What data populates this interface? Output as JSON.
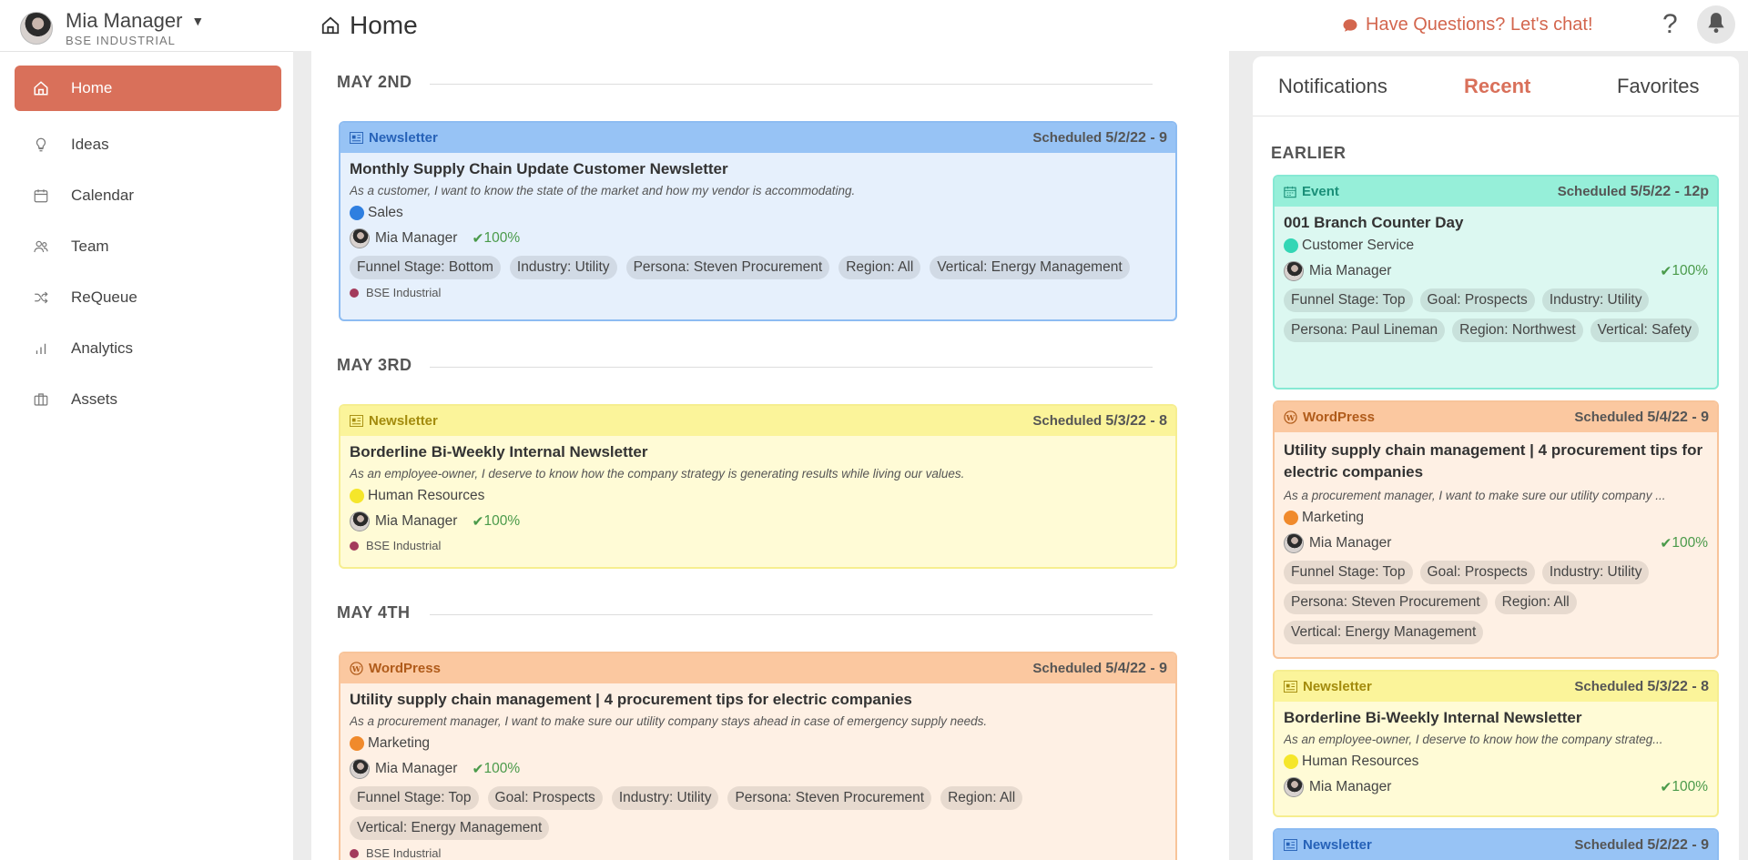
{
  "header": {
    "user_name": "Mia Manager",
    "user_org": "BSE INDUSTRIAL",
    "page_title": "Home",
    "chat_label": "Have Questions? Let's chat!",
    "help_glyph": "?"
  },
  "sidebar": {
    "items": [
      {
        "label": "Home",
        "icon": "home-icon",
        "active": true
      },
      {
        "label": "Ideas",
        "icon": "lightbulb-icon"
      },
      {
        "label": "Calendar",
        "icon": "calendar-icon"
      },
      {
        "label": "Team",
        "icon": "team-icon"
      },
      {
        "label": "ReQueue",
        "icon": "shuffle-icon"
      },
      {
        "label": "Analytics",
        "icon": "bar-chart-icon"
      },
      {
        "label": "Assets",
        "icon": "briefcase-icon"
      }
    ]
  },
  "main": {
    "days": [
      "MAY 2ND",
      "MAY 3RD",
      "MAY 4TH"
    ],
    "cards": [
      {
        "type": "Newsletter",
        "sched_label": "Scheduled",
        "sched_value": "5/2/22 - 9",
        "title": "Monthly Supply Chain Update Customer Newsletter",
        "desc": "As a customer, I want to know the state of the market and how my vendor is accommodating.",
        "dept": "Sales",
        "owner": "Mia Manager",
        "pct": "100%",
        "tags": [
          "Funnel Stage: Bottom",
          "Industry: Utility",
          "Persona: Steven Procurement",
          "Region: All",
          "Vertical: Energy Management"
        ],
        "org": "BSE Industrial"
      },
      {
        "type": "Newsletter",
        "sched_label": "Scheduled",
        "sched_value": "5/3/22 - 8",
        "title": "Borderline Bi-Weekly Internal Newsletter",
        "desc": "As an employee-owner, I deserve to know how the company strategy is generating results while living our values.",
        "dept": "Human Resources",
        "owner": "Mia Manager",
        "pct": "100%",
        "org": "BSE Industrial"
      },
      {
        "type": "WordPress",
        "sched_label": "Scheduled",
        "sched_value": "5/4/22 - 9",
        "title": "Utility supply chain management | 4 procurement tips for electric companies",
        "desc": "As a procurement manager, I want to make sure our utility company stays ahead in case of emergency supply needs.",
        "dept": "Marketing",
        "owner": "Mia Manager",
        "pct": "100%",
        "tags": [
          "Funnel Stage: Top",
          "Goal: Prospects",
          "Industry: Utility",
          "Persona: Steven Procurement",
          "Region: All",
          "Vertical: Energy Management"
        ],
        "org": "BSE Industrial"
      }
    ]
  },
  "right_panel": {
    "tabs": [
      "Notifications",
      "Recent",
      "Favorites"
    ],
    "section": "EARLIER",
    "cards": [
      {
        "type": "Event",
        "sched_label": "Scheduled",
        "sched_value": "5/5/22 - 12p",
        "title": "001 Branch Counter Day",
        "dept": "Customer Service",
        "owner": "Mia Manager",
        "pct": "100%",
        "tags": [
          "Funnel Stage: Top",
          "Goal: Prospects",
          "Industry: Utility",
          "Persona: Paul Lineman",
          "Region: Northwest",
          "Vertical: Safety"
        ]
      },
      {
        "type": "WordPress",
        "sched_label": "Scheduled",
        "sched_value": "5/4/22 - 9",
        "title": "Utility supply chain management | 4 procurement tips for electric companies",
        "desc": "As a procurement manager, I want to make sure our utility company ...",
        "dept": "Marketing",
        "owner": "Mia Manager",
        "pct": "100%",
        "tags": [
          "Funnel Stage: Top",
          "Goal: Prospects",
          "Industry: Utility",
          "Persona: Steven Procurement",
          "Region: All",
          "Vertical: Energy Management"
        ]
      },
      {
        "type": "Newsletter",
        "sched_label": "Scheduled",
        "sched_value": "5/3/22 - 8",
        "title": "Borderline Bi-Weekly Internal Newsletter",
        "desc": "As an employee-owner, I deserve to know how the company strateg...",
        "dept": "Human Resources",
        "owner": "Mia Manager",
        "pct": "100%"
      },
      {
        "type": "Newsletter",
        "sched_label": "Scheduled",
        "sched_value": "5/2/22 - 9"
      }
    ]
  },
  "colors": {
    "accent": "#d9705a",
    "newsletter_blue": "#97c3f5",
    "newsletter_yellow": "#fbf49a",
    "wordpress_orange": "#fbc8a0",
    "event_teal": "#96efd9",
    "dept_sales": "#2f7fe0",
    "dept_hr": "#f5e62a",
    "dept_marketing": "#f08a2c",
    "dept_customer_service": "#33d6b5",
    "success_green": "#4a9a4a"
  }
}
